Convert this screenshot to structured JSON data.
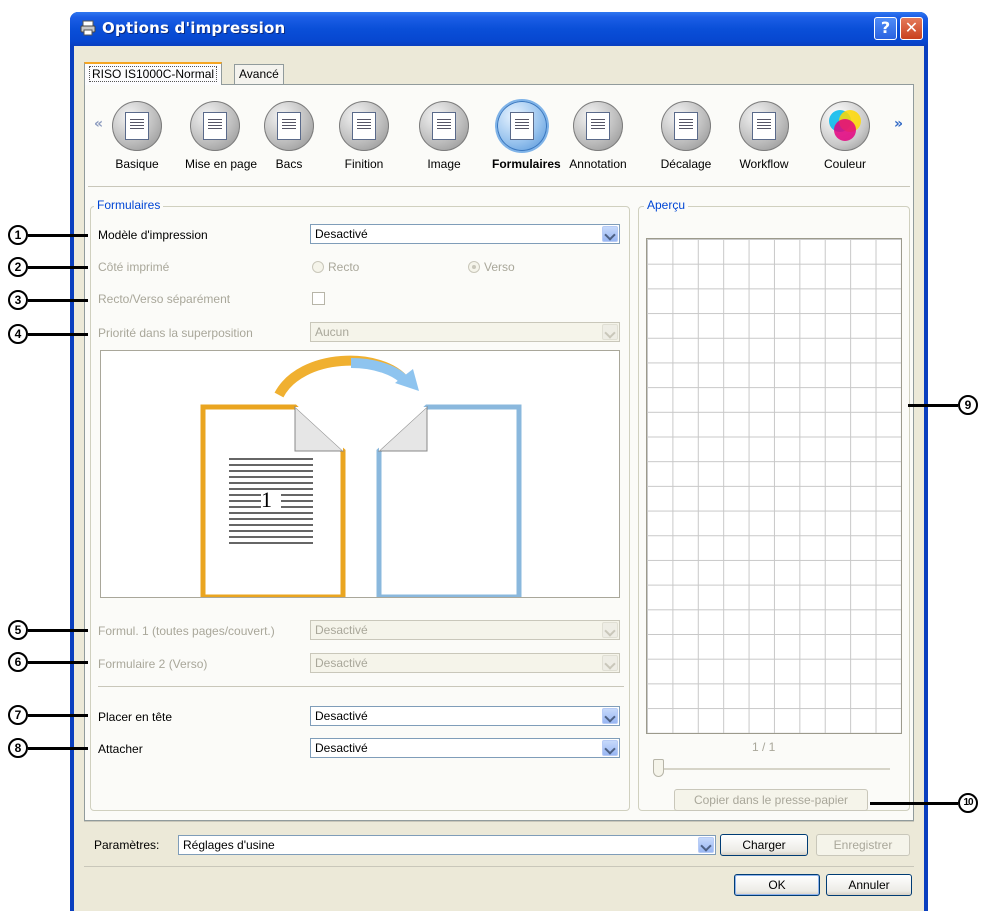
{
  "window": {
    "title": "Options d'impression",
    "help_glyph": "?",
    "close_glyph": "✕"
  },
  "tabs": [
    {
      "label": "RISO IS1000C-Normal",
      "active": true
    },
    {
      "label": "Avancé",
      "active": false
    }
  ],
  "categories": [
    {
      "label": "Basique",
      "icon": "document-icon"
    },
    {
      "label": "Mise en page",
      "icon": "layout-icon"
    },
    {
      "label": "Bacs",
      "icon": "trays-icon"
    },
    {
      "label": "Finition",
      "icon": "finishing-icon"
    },
    {
      "label": "Image",
      "icon": "image-icon"
    },
    {
      "label": "Formulaires",
      "icon": "forms-icon",
      "active": true
    },
    {
      "label": "Annotation",
      "icon": "annotation-icon"
    },
    {
      "label": "Décalage",
      "icon": "offset-icon"
    },
    {
      "label": "Workflow",
      "icon": "workflow-icon"
    },
    {
      "label": "Couleur",
      "icon": "color-icon"
    }
  ],
  "nav": {
    "prev": "«",
    "next": "»"
  },
  "formulaires": {
    "group_title": "Formulaires",
    "modele_label": "Modèle d'impression",
    "modele_value": "Desactivé",
    "cote_label": "Côté imprimé",
    "recto_label": "Recto",
    "verso_label": "Verso",
    "recto_verso_label": "Recto/Verso séparément",
    "priorite_label": "Priorité dans la superposition",
    "priorite_value": "Aucun",
    "illustration_number": "1",
    "formul1_label": "Formul. 1 (toutes pages/couvert.)",
    "formul1_value": "Desactivé",
    "formul2_label": "Formulaire 2 (Verso)",
    "formul2_value": "Desactivé",
    "placer_label": "Placer en tête",
    "placer_value": "Desactivé",
    "attacher_label": "Attacher",
    "attacher_value": "Desactivé"
  },
  "apercu": {
    "group_title": "Aperçu",
    "page_indicator": "1 / 1",
    "copy_button": "Copier dans le presse-papier"
  },
  "footer": {
    "parametres_label": "Paramètres:",
    "parametres_value": "Réglages d'usine",
    "charger_button": "Charger",
    "enregistrer_button": "Enregistrer",
    "ok_button": "OK",
    "annuler_button": "Annuler"
  },
  "callouts": [
    "1",
    "2",
    "3",
    "4",
    "5",
    "6",
    "7",
    "8",
    "9",
    "10"
  ]
}
